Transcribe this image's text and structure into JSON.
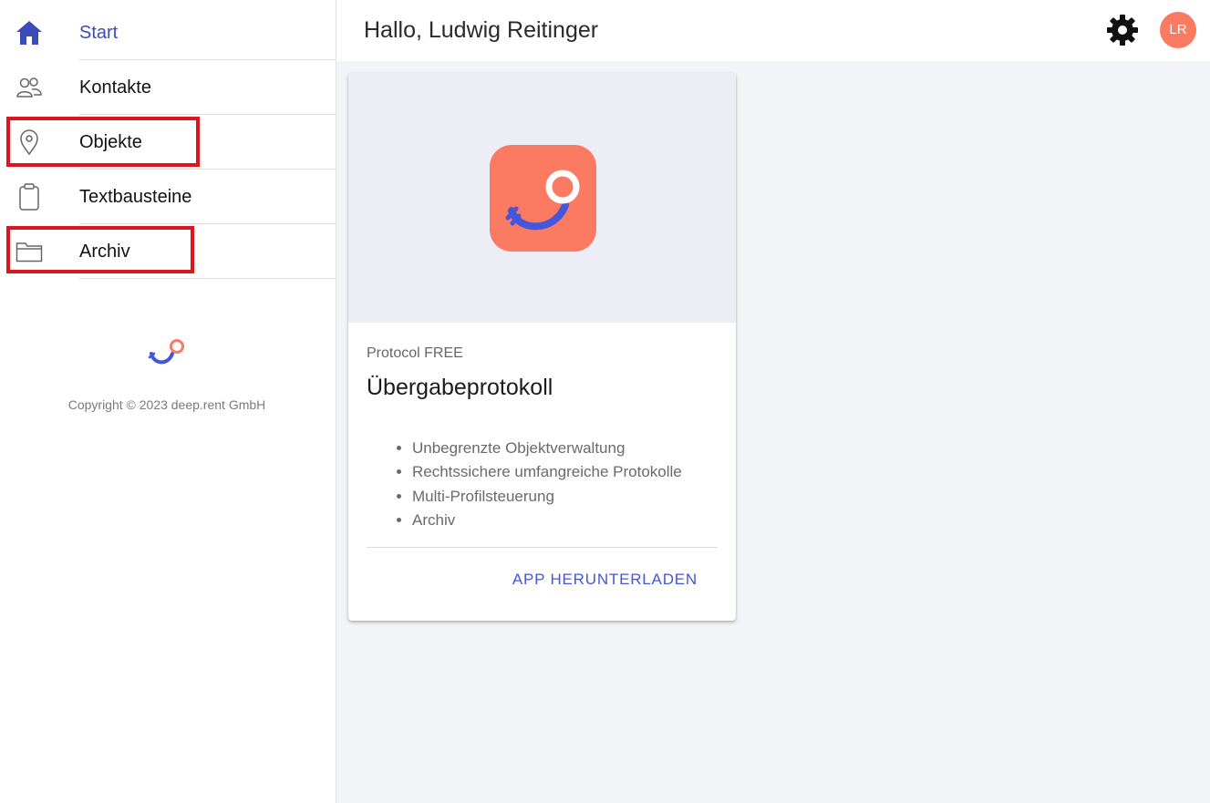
{
  "sidebar": {
    "items": [
      {
        "label": "Start",
        "icon": "home-icon",
        "active": true
      },
      {
        "label": "Kontakte",
        "icon": "contacts-icon"
      },
      {
        "label": "Objekte",
        "icon": "location-pin-icon",
        "highlighted": true
      },
      {
        "label": "Textbausteine",
        "icon": "clipboard-icon"
      },
      {
        "label": "Archiv",
        "icon": "folder-icon",
        "highlighted": true
      }
    ],
    "copyright": "Copyright © 2023 deep.rent GmbH"
  },
  "header": {
    "greeting": "Hallo, Ludwig Reitinger",
    "avatar_initials": "LR"
  },
  "card": {
    "subtitle": "Protocol FREE",
    "title": "Übergabeprotokoll",
    "features": [
      "Unbegrenzte Objektverwaltung",
      "Rechtssichere umfangreiche Protokolle",
      "Multi-Profilsteuerung",
      "Archiv"
    ],
    "action_label": "APP HERUNTERLADEN"
  },
  "colors": {
    "accent_blue": "#3b4cb8",
    "brand_coral": "#fa7a62",
    "highlight_red": "#e0141c",
    "link_blue": "#4456d9"
  }
}
